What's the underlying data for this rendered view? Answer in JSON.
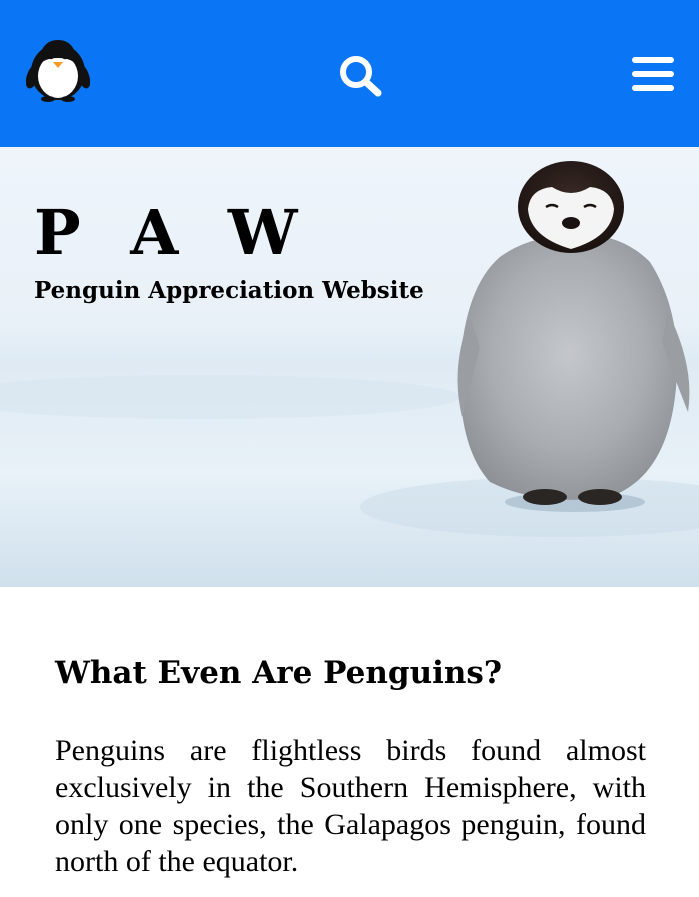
{
  "header": {
    "background_color": "#0a76f5",
    "logo_icon": "penguin-logo-icon",
    "search_icon": "search-icon",
    "menu_icon": "hamburger-menu-icon"
  },
  "hero": {
    "title": "P A W",
    "subtitle": "Penguin Appreciation Website",
    "image": "penguin-chick-on-snow"
  },
  "main": {
    "heading": "What Even Are Penguins?",
    "paragraph": "Penguins are flightless birds found almost exclusively in the Southern Hemisphere, with only one species, the Galapagos penguin, found north of the equator."
  }
}
